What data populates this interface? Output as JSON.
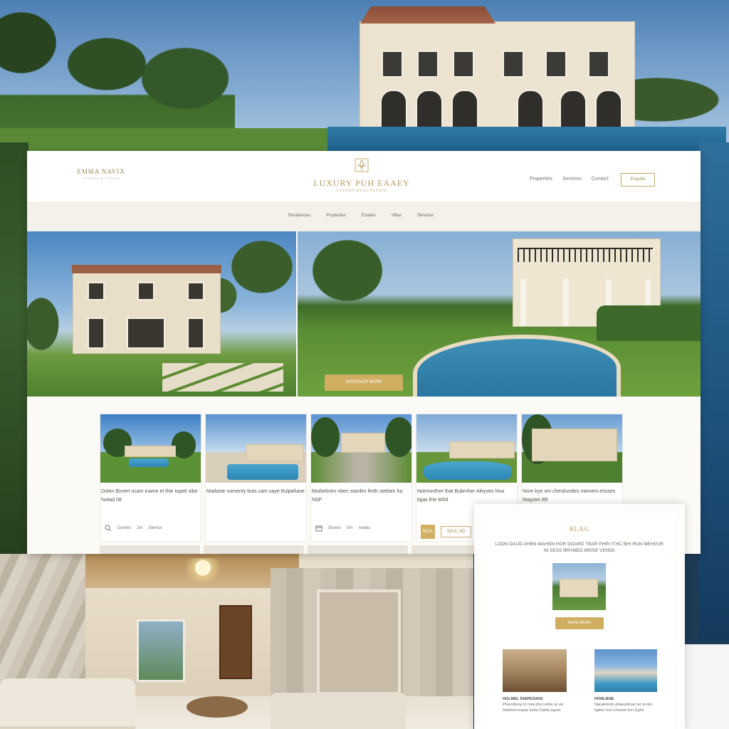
{
  "site": {
    "logo_left_name": "EMMA NAVIX",
    "logo_left_sub": "ESTATES & VILLAS",
    "brand_title": "LUXURY PUH EAAEY",
    "brand_tagline": "LUXURY REAL ESTATE",
    "top_links": [
      "Properties",
      "Services",
      "Contact"
    ],
    "top_cta": "Enquire",
    "subnav": [
      "Residences",
      "Properties",
      "Estates",
      "Villas",
      "Services"
    ],
    "hero_button": "DISCOVER MORE"
  },
  "listings": [
    {
      "desc": "Dolen Birvert ocam iname et thie topeti sibe hoitad 08",
      "meta": [
        "Domes",
        "2m",
        "Stemor"
      ]
    },
    {
      "desc": "Matlaste nomenty bras cam saye Bulpahase",
      "meta": []
    },
    {
      "desc": "Morbeliven nben stardes fer8r stebien ha NSP",
      "meta": [
        "Sloves",
        "5m",
        "Aedes"
      ]
    },
    {
      "desc": "Notrinerther that Bubrnher Aleyves hiva tigas Ete MA9",
      "meta": [
        "SEVL",
        "SEVL ND"
      ]
    },
    {
      "desc": "Nore bye om chestlundes mienem erisses Magstet 8R",
      "meta": []
    }
  ],
  "blog": {
    "title": "BLAG",
    "intro": "LODN DAUD AHBN MAHNN HOR DOARD TBAR PHRI ITHC BHI RUN MEHGVE IN SESS BRYMED BRISE VENEK",
    "button": "READ MORE",
    "posts": [
      {
        "title": "HOLMEL DIAPESAKE",
        "body": "Pherotilons to niea lihe notbe at uiv fidsthed enpaa lunte Caldis tigeni"
      },
      {
        "title": "HONLIE9E",
        "body": "Nanalrestin phaestirnas ter at dre tigthe cnd Lohoem lcvr Eghs"
      }
    ]
  }
}
